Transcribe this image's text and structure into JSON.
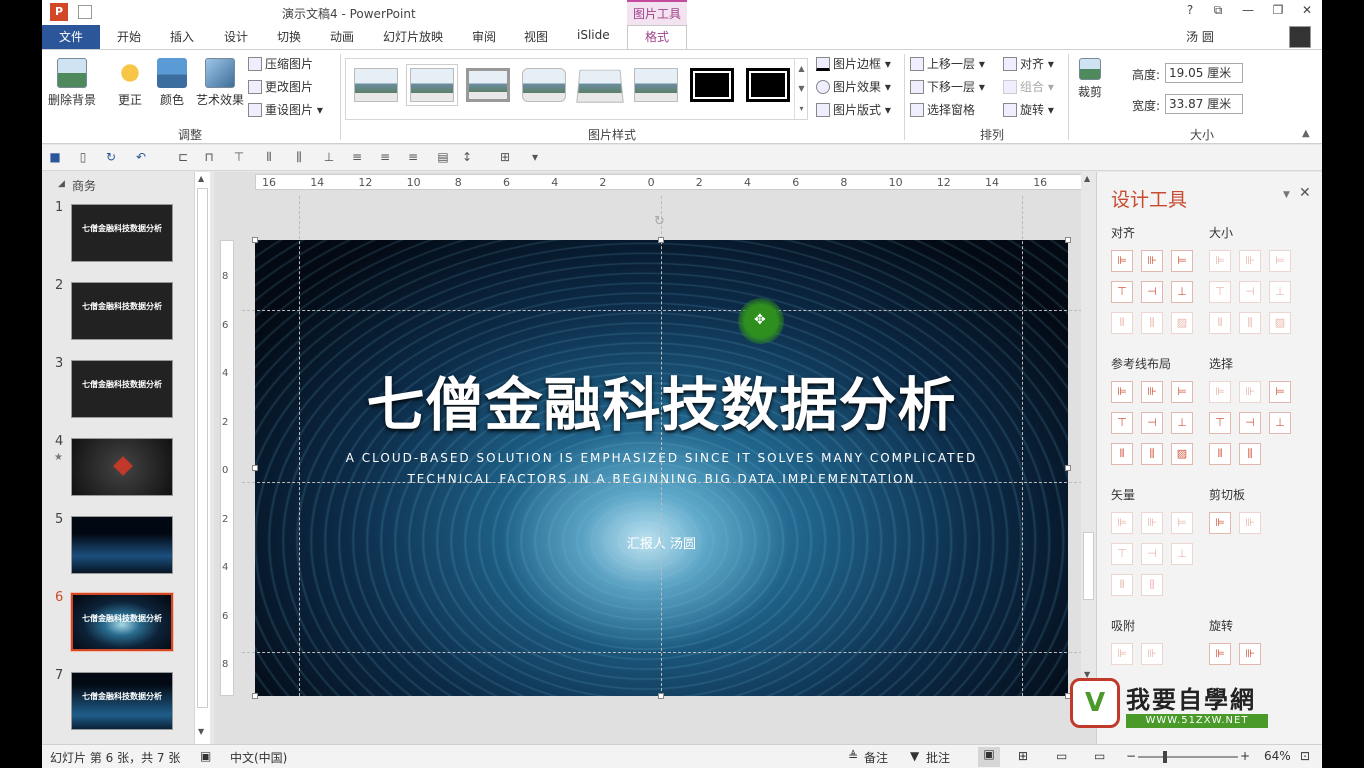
{
  "app": {
    "title": "演示文稿4 - PowerPoint",
    "context_tab": "图片工具",
    "user": "汤 圆"
  },
  "tabs": [
    "文件",
    "开始",
    "插入",
    "设计",
    "切换",
    "动画",
    "幻灯片放映",
    "审阅",
    "视图",
    "iSlide",
    "格式"
  ],
  "ribbon": {
    "adjust": {
      "remove_bg": "删除背景",
      "correct": "更正",
      "color": "颜色",
      "art_effect": "艺术效果",
      "compress": "压缩图片",
      "change": "更改图片",
      "reset": "重设图片",
      "group_label": "调整"
    },
    "styles": {
      "border": "图片边框",
      "effect": "图片效果",
      "layout": "图片版式",
      "group_label": "图片样式"
    },
    "arrange": {
      "bring_forward": "上移一层",
      "send_backward": "下移一层",
      "selection_pane": "选择窗格",
      "align": "对齐",
      "group": "组合",
      "rotate": "旋转",
      "group_label": "排列"
    },
    "size": {
      "crop": "裁剪",
      "height_label": "高度:",
      "height_value": "19.05 厘米",
      "width_label": "宽度:",
      "width_value": "33.87 厘米",
      "group_label": "大小"
    }
  },
  "thumbs": {
    "section": "商务",
    "slides": [
      {
        "num": "1",
        "title": "七僧金融科技数据分析"
      },
      {
        "num": "2",
        "title": "七僧金融科技数据分析"
      },
      {
        "num": "3",
        "title": "七僧金融科技数据分析"
      },
      {
        "num": "4",
        "title": "",
        "star": "★"
      },
      {
        "num": "5",
        "title": ""
      },
      {
        "num": "6",
        "title": "七僧金融科技数据分析"
      },
      {
        "num": "7",
        "title": "七僧金融科技数据分析"
      }
    ]
  },
  "ruler": {
    "h": [
      "16",
      "14",
      "12",
      "10",
      "8",
      "6",
      "4",
      "2",
      "0",
      "2",
      "4",
      "6",
      "8",
      "10",
      "12",
      "14",
      "16"
    ],
    "v": [
      "8",
      "6",
      "4",
      "2",
      "0",
      "2",
      "4",
      "6",
      "8"
    ]
  },
  "slide": {
    "title": "七僧金融科技数据分析",
    "sub1": "A CLOUD-BASED SOLUTION IS EMPHASIZED SINCE IT SOLVES MANY COMPLICATED",
    "sub2": "TECHNICAL FACTORS IN A BEGINNING BIG DATA IMPLEMENTATION",
    "reporter": "汇报人  汤圆"
  },
  "design_tools": {
    "title": "设计工具",
    "align": "对齐",
    "size": "大小",
    "guides": "参考线布局",
    "select": "选择",
    "vector": "矢量",
    "clipboard": "剪切板",
    "snap": "吸附",
    "rotate": "旋转"
  },
  "status": {
    "slide_info": "幻灯片 第 6 张，共 7 张",
    "lang": "中文(中国)",
    "notes": "备注",
    "comments": "批注",
    "zoom": "64%"
  },
  "watermark": {
    "brand": "我要自學網",
    "url": "WWW.51ZXW.NET"
  },
  "colors": {
    "file_tab": "#2b579a",
    "context": "#a0428a",
    "design_accent": "#c84a2f",
    "selected_slide": "#d24726"
  }
}
